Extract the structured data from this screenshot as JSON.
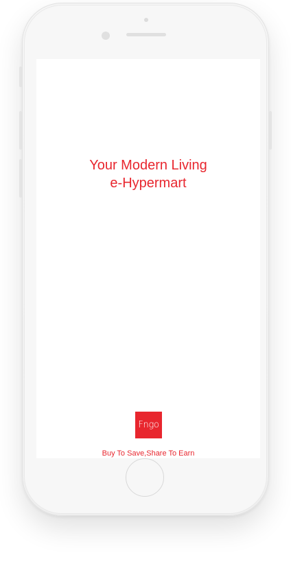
{
  "screen": {
    "tagline_line1": "Your Modern Living",
    "tagline_line2": "e-Hypermart",
    "logo_text": "Fngo",
    "slogan": "Buy To Save,Share To Earn"
  },
  "colors": {
    "brand_red": "#e8262e",
    "screen_background": "#ffffff",
    "device_body": "#f4f4f4"
  },
  "icons": {
    "home_button": "home-button-circle",
    "front_camera": "camera-dot",
    "speaker": "speaker-grille"
  }
}
